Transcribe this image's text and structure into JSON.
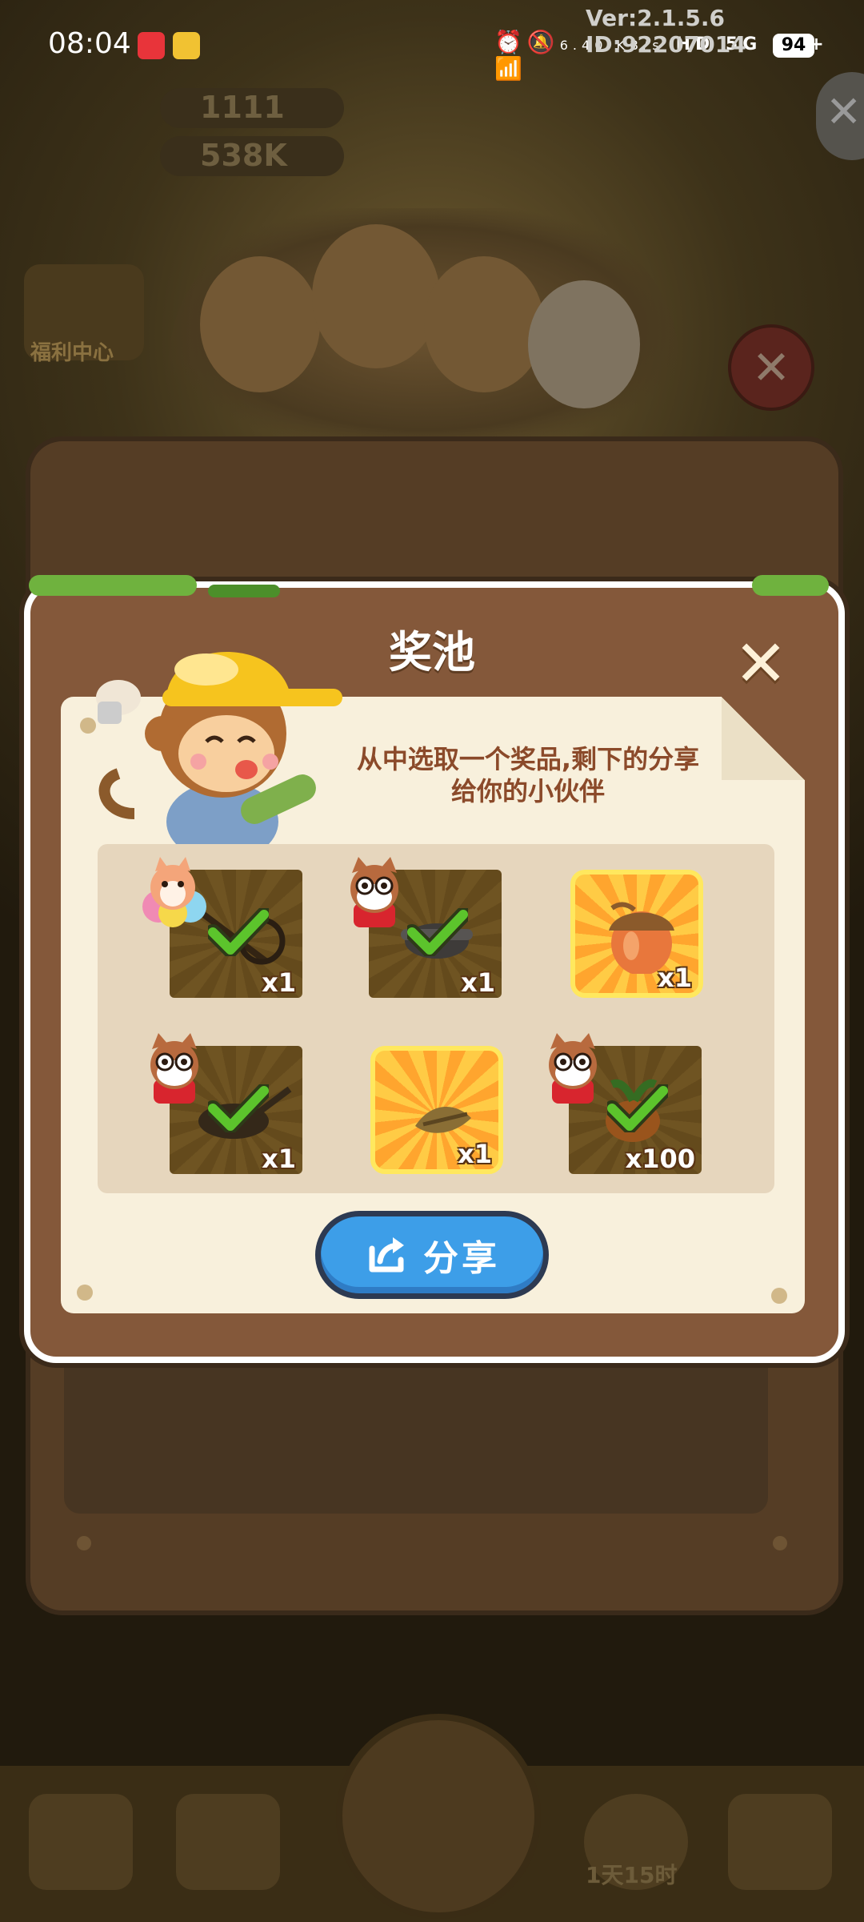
{
  "status_bar": {
    "time": "08:04",
    "network_speed": "6.40\nKB/s",
    "signal_labels": "HD 5G 4G+",
    "battery": "94",
    "version_text": "Ver:2.1.5.6 ID:92207014"
  },
  "background": {
    "hearts_count": "1111",
    "coins_count": "538K",
    "left_badge": "福利中心",
    "bottom_timer": "1天15时"
  },
  "dialog": {
    "title": "奖池",
    "subtitle_line1": "从中选取一个奖品,剩下的分享",
    "subtitle_line2": "给你的小伙伴",
    "share_label": "分享"
  },
  "rewards": [
    {
      "item": "fishing-rod",
      "qty": "x1",
      "claimed": true,
      "avatar": "squirrel-rainbow"
    },
    {
      "item": "iron-pot",
      "qty": "x1",
      "claimed": true,
      "avatar": "raccoon-glasses"
    },
    {
      "item": "acorn",
      "qty": "x1",
      "claimed": false,
      "avatar": ""
    },
    {
      "item": "frying-pan",
      "qty": "x1",
      "claimed": true,
      "avatar": "raccoon-glasses"
    },
    {
      "item": "branch",
      "qty": "x1",
      "claimed": false,
      "avatar": ""
    },
    {
      "item": "carrot",
      "qty": "x100",
      "claimed": true,
      "avatar": "raccoon-glasses"
    }
  ],
  "colors": {
    "dialog_wood": "#84583a",
    "paper": "#f8f0dc",
    "share_blue": "#3d9ee8",
    "check_green": "#5cc42c",
    "slot_gold": "#ffb53a"
  }
}
